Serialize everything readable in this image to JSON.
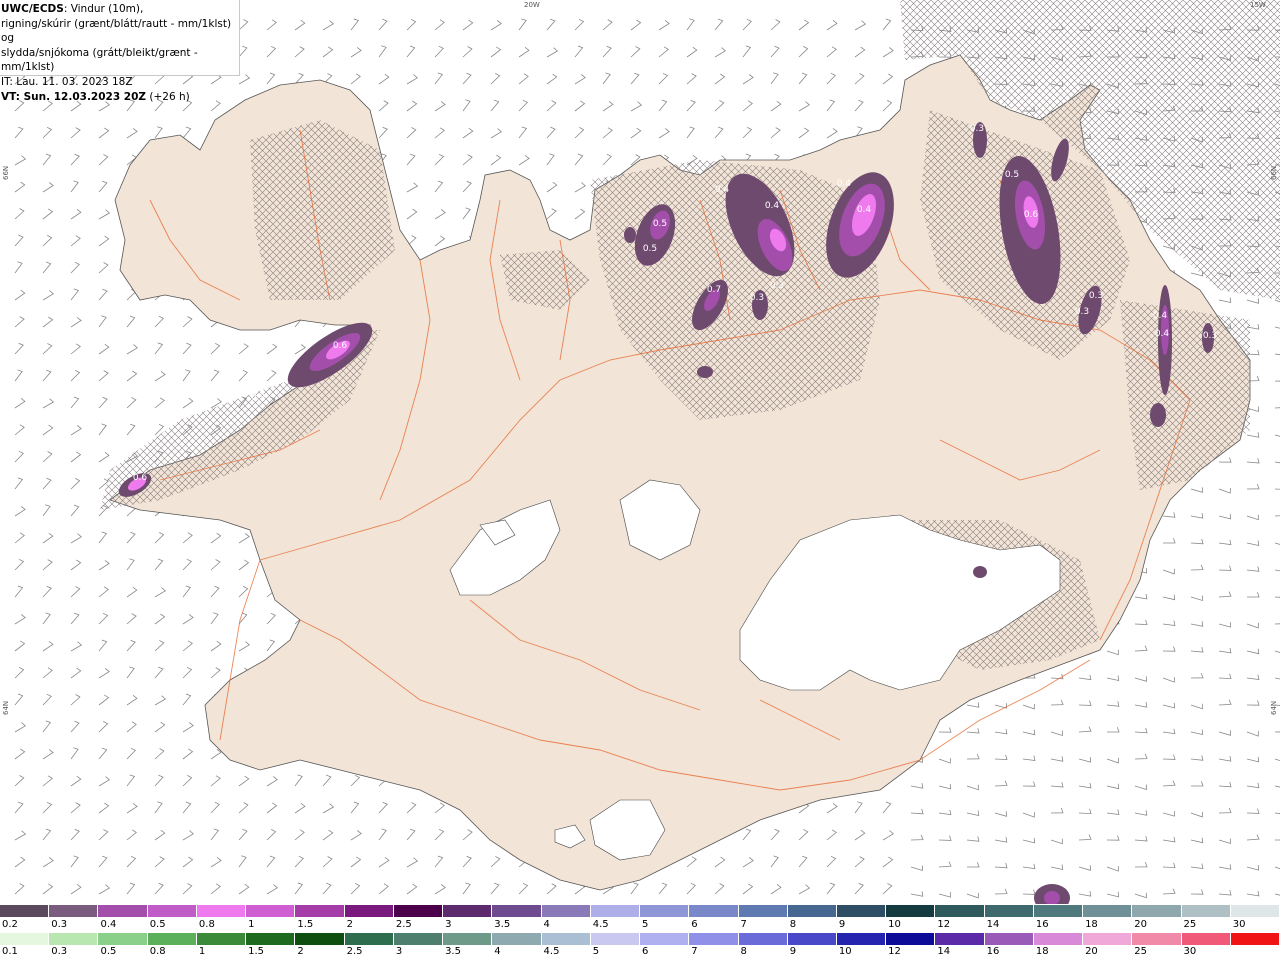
{
  "header": {
    "line1_bold": "UWC/ECDS",
    "line1_rest": ": Vindur (10m),",
    "line2": "rigning/skúrir (grænt/blátt/rautt - mm/1klst) og",
    "line3": "slydda/snjókoma (grátt/bleikt/grænt - mm/1klst)",
    "line4": "IT: Lau. 11. 03. 2023 18Z",
    "line5_bold": "VT: Sun. 12.03.2023 20Z",
    "line5_rest": " (+26 h)"
  },
  "graticule": {
    "top_20w": "20W",
    "top_15w": "15W",
    "left_66n": "66N",
    "left_64n": "64N",
    "right_66n": "66N",
    "right_64n": "64N"
  },
  "colors": {
    "sea": "#ffffff",
    "land": "#f2e4d6",
    "glacier": "#ffffff",
    "roads": "#e8703c",
    "precip_dark": "#6e4a6e",
    "precip_mid": "#a24eaa",
    "precip_light": "#ee7aee"
  },
  "precip_labels": [
    "0.3",
    "0.6",
    "0.6",
    "0.5",
    "0.5",
    "0.4",
    "0.4",
    "0.3",
    "0.7",
    "0.3",
    "0.4",
    "0.4",
    "0.5",
    "0.6",
    "0.3",
    "0.3",
    "0.4",
    "0.4",
    "0.3",
    "0.3"
  ],
  "legend_snow": {
    "labels": [
      "0.2",
      "0.3",
      "0.4",
      "0.5",
      "0.8",
      "1",
      "1.5",
      "2",
      "2.5",
      "3",
      "3.5",
      "4",
      "4.5",
      "5",
      "6",
      "7",
      "8",
      "9",
      "10",
      "12",
      "14",
      "16",
      "18",
      "20",
      "25",
      "30"
    ],
    "colors": [
      "#5b4a5e",
      "#7a5c7e",
      "#a24eaa",
      "#c05cc8",
      "#ee7aee",
      "#cf5ed2",
      "#a53ca8",
      "#7a1a7e",
      "#4c004c",
      "#5e2a6e",
      "#6e4a8e",
      "#8a7ab8",
      "#aeaee8",
      "#8e96d8",
      "#7888c8",
      "#5e7ab0",
      "#466890",
      "#2e4e66",
      "#143c40",
      "#2e5a5e",
      "#3e6a6e",
      "#4e7a7e",
      "#6e9096",
      "#8ea8ae",
      "#aec0c4",
      "#dfe6e8"
    ]
  },
  "legend_rain": {
    "labels": [
      "0.1",
      "0.3",
      "0.5",
      "0.8",
      "1",
      "1.5",
      "2",
      "2.5",
      "3",
      "3.5",
      "4",
      "4.5",
      "5",
      "6",
      "7",
      "8",
      "9",
      "10",
      "12",
      "14",
      "16",
      "18",
      "20",
      "25",
      "30"
    ],
    "colors": [
      "#e6f7e0",
      "#b8e8b0",
      "#8ad08a",
      "#5cb05c",
      "#3a8a3a",
      "#1e6a1e",
      "#0e4e0e",
      "#2e6e4e",
      "#4e7e6e",
      "#6e9a8a",
      "#8eaab0",
      "#aabed4",
      "#c8c8f0",
      "#b0b0f0",
      "#9090e8",
      "#6a6ad8",
      "#4848c8",
      "#2424b0",
      "#0c0c98",
      "#5a2aa8",
      "#9a5ab8",
      "#d88ad8",
      "#f0a8d8",
      "#f08aa8",
      "#f05a78",
      "#f01414"
    ]
  }
}
